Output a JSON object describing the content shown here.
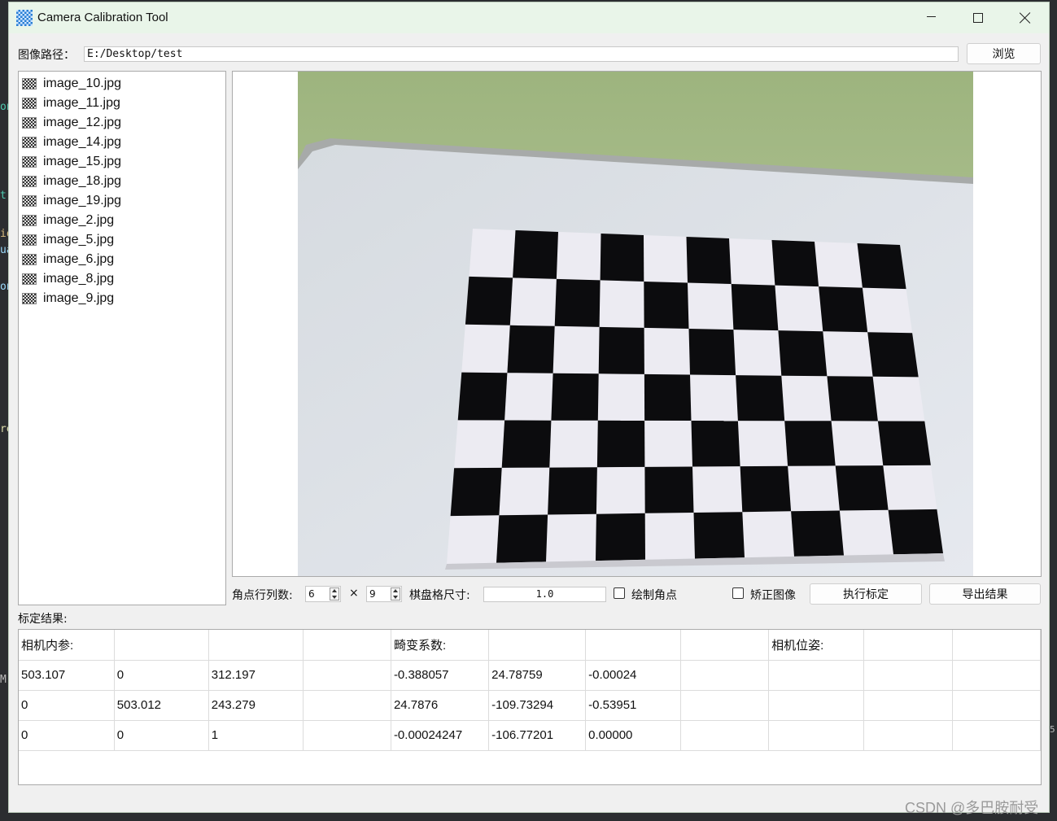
{
  "window": {
    "title": "Camera Calibration Tool"
  },
  "path": {
    "label": "图像路径：",
    "value": "E:/Desktop/test",
    "browse_label": "浏览"
  },
  "files": [
    "image_10.jpg",
    "image_11.jpg",
    "image_12.jpg",
    "image_14.jpg",
    "image_15.jpg",
    "image_18.jpg",
    "image_19.jpg",
    "image_2.jpg",
    "image_5.jpg",
    "image_6.jpg",
    "image_8.jpg",
    "image_9.jpg"
  ],
  "controls": {
    "corner_label": "角点行列数:",
    "rows": "6",
    "times": "×",
    "cols": "9",
    "square_label": "棋盘格尺寸:",
    "square_size": "1.0",
    "draw_corners_label": "绘制角点",
    "undistort_label": "矫正图像",
    "run_label": "执行标定",
    "export_label": "导出结果"
  },
  "results": {
    "label": "标定结果:",
    "rows": [
      [
        "相机内参:",
        "",
        "",
        "",
        "畸变系数:",
        "",
        "",
        "",
        "相机位姿:",
        "",
        ""
      ],
      [
        "503.107",
        "0",
        "312.197",
        "",
        "-0.388057",
        "24.78759",
        "-0.00024",
        "",
        "",
        "",
        ""
      ],
      [
        "0",
        "503.012",
        "243.279",
        "",
        "24.7876",
        "-109.73294",
        "-0.53951",
        "",
        "",
        "",
        ""
      ],
      [
        "0",
        "0",
        "1",
        "",
        "-0.00024247",
        "-106.77201",
        "0.00000",
        "",
        "",
        "",
        ""
      ]
    ]
  },
  "background_fragments": [
    "on",
    "t",
    "io",
    "ua",
    "on",
    "re",
    "M",
    "5"
  ],
  "watermark": "CSDN @多巴胺耐受",
  "colors": {
    "titlebar": "#e9f5e9",
    "window": "#f0f0f0",
    "board_green": "#a9bf8c"
  }
}
